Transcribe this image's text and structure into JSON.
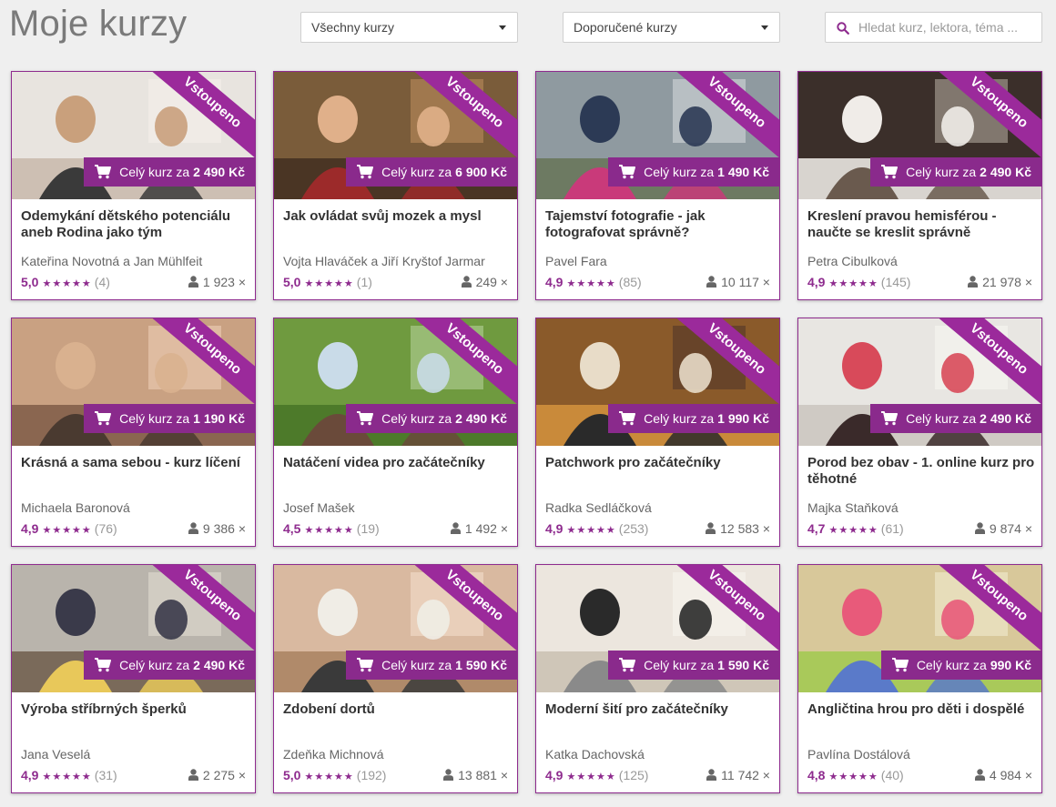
{
  "header": {
    "title": "Moje kurzy",
    "filter_select": "Všechny kurzy",
    "sort_select": "Doporučené kurzy",
    "search_placeholder": "Hledat kurz, lektora, téma ..."
  },
  "colors": {
    "accent": "#8e2b8e",
    "ribbon": "#9b2a9b",
    "price_bar": "#8a2a8c"
  },
  "icons": {
    "search": "search-icon",
    "cart": "cart-icon",
    "students": "user-icon",
    "dropdown": "chevron-down-icon"
  },
  "badge_label": "Vstoupeno",
  "price_prefix": "Celý kurz za",
  "courses": [
    {
      "title": "Odemykání dětského potenciálu aneb Rodina jako tým",
      "author": "Kateřina Novotná a Jan Mühlfeit",
      "price": "2 490 Kč",
      "rating": "5,0",
      "stars": "★★★★★",
      "reviews": "(4)",
      "students": "1 923 ×"
    },
    {
      "title": "Jak ovládat svůj mozek a mysl",
      "author": "Vojta Hlaváček a Jiří Kryštof Jarmar",
      "price": "6 900 Kč",
      "rating": "5,0",
      "stars": "★★★★★",
      "reviews": "(1)",
      "students": "249 ×"
    },
    {
      "title": "Tajemství fotografie - jak fotografovat správně?",
      "author": "Pavel Fara",
      "price": "1 490 Kč",
      "rating": "4,9",
      "stars": "★★★★★",
      "reviews": "(85)",
      "students": "10 117 ×"
    },
    {
      "title": "Kreslení pravou hemisférou - naučte se kreslit správně",
      "author": "Petra Cibulková",
      "price": "2 490 Kč",
      "rating": "4,9",
      "stars": "★★★★★",
      "reviews": "(145)",
      "students": "21 978 ×"
    },
    {
      "title": "Krásná a sama sebou - kurz líčení",
      "author": "Michaela Baronová",
      "price": "1 190 Kč",
      "rating": "4,9",
      "stars": "★★★★★",
      "reviews": "(76)",
      "students": "9 386 ×"
    },
    {
      "title": "Natáčení videa pro začátečníky",
      "author": "Josef Mašek",
      "price": "2 490 Kč",
      "rating": "4,5",
      "stars": "★★★★★",
      "reviews": "(19)",
      "students": "1 492 ×"
    },
    {
      "title": "Patchwork pro začátečníky",
      "author": "Radka Sedláčková",
      "price": "1 990 Kč",
      "rating": "4,9",
      "stars": "★★★★★",
      "reviews": "(253)",
      "students": "12 583 ×"
    },
    {
      "title": "Porod bez obav - 1. online kurz pro těhotné",
      "author": "Majka Staňková",
      "price": "2 490 Kč",
      "rating": "4,7",
      "stars": "★★★★★",
      "reviews": "(61)",
      "students": "9 874 ×"
    },
    {
      "title": "Výroba stříbrných šperků",
      "author": "Jana Veselá",
      "price": "2 490 Kč",
      "rating": "4,9",
      "stars": "★★★★★",
      "reviews": "(31)",
      "students": "2 275 ×"
    },
    {
      "title": "Zdobení dortů",
      "author": "Zdeňka Michnová",
      "price": "1 590 Kč",
      "rating": "5,0",
      "stars": "★★★★★",
      "reviews": "(192)",
      "students": "13 881 ×"
    },
    {
      "title": "Moderní šití pro začátečníky",
      "author": "Katka Dachovská",
      "price": "1 590 Kč",
      "rating": "4,9",
      "stars": "★★★★★",
      "reviews": "(125)",
      "students": "11 742 ×"
    },
    {
      "title": "Angličtina hrou pro děti i dospělé",
      "author": "Pavlína Dostálová",
      "price": "990 Kč",
      "rating": "4,8",
      "stars": "★★★★★",
      "reviews": "(40)",
      "students": "4 984 ×"
    }
  ]
}
